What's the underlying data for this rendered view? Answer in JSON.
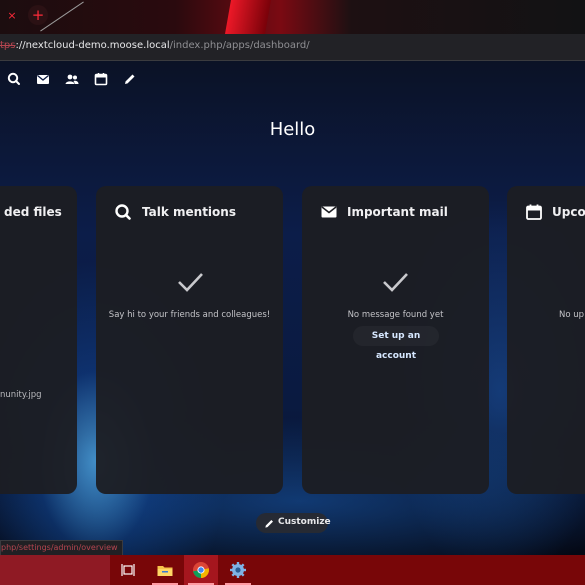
{
  "browser": {
    "tab_close_glyph": "×",
    "new_tab_glyph": "+",
    "url": {
      "scheme": "tps",
      "host": "://nextcloud-demo.moose.local",
      "path": "/index.php/apps/dashboard/"
    }
  },
  "appbar": {
    "icons": [
      "search-icon",
      "mail-icon",
      "contacts-icon",
      "calendar-icon",
      "pencil-icon"
    ]
  },
  "dashboard": {
    "greeting": "Hello",
    "widgets": [
      {
        "title": "ded files",
        "icon": null,
        "item": "nunity.jpg"
      },
      {
        "title": "Talk mentions",
        "icon": "search-icon",
        "empty_text": "Say hi to your friends and colleagues!"
      },
      {
        "title": "Important mail",
        "icon": "mail-icon",
        "empty_text": "No message found yet",
        "action": "Set up an account"
      },
      {
        "title": "Upco",
        "icon": "calendar-icon",
        "empty_text": "No up"
      }
    ],
    "customize_label": "Customize"
  },
  "statusbar": {
    "link": "php/settings/admin/overview"
  },
  "taskbar": {
    "items": [
      "task-view-icon",
      "file-explorer-icon",
      "chrome-icon",
      "settings-icon"
    ],
    "active": "chrome-icon",
    "colors": {
      "background": "#780608",
      "highlight": "#a5161e"
    }
  },
  "colors": {
    "card": "#1c1d23",
    "accent_link": "#d6e7ff",
    "page_top": "#0b1226"
  }
}
